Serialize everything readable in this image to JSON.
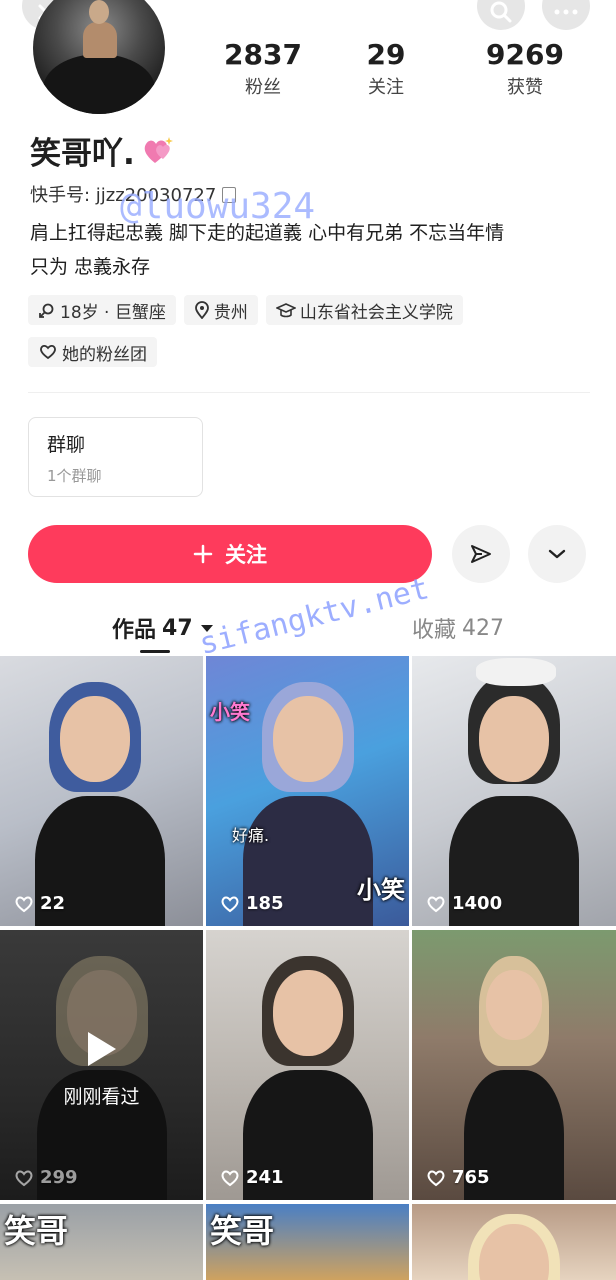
{
  "header": {
    "back_icon": "close-icon",
    "search_icon": "search-icon",
    "more_icon": "more-icon"
  },
  "profile": {
    "stats": [
      {
        "value": "2837",
        "label": "粉丝"
      },
      {
        "value": "29",
        "label": "关注"
      },
      {
        "value": "9269",
        "label": "获赞"
      }
    ],
    "nickname": "笑哥吖.",
    "kuaishou_id": "快手号: jjzz20030727",
    "bio_line1": "肩上扛得起忠義 脚下走的起道義 心中有兄弟 不忘当年情",
    "bio_line2": "只为 忠義永存",
    "tags": [
      {
        "icon": "gender-icon",
        "text": "18岁 · 巨蟹座"
      },
      {
        "icon": "location-icon",
        "text": "贵州"
      },
      {
        "icon": "school-icon",
        "text": "山东省社会主义学院"
      }
    ],
    "fan_group": "她的粉丝团"
  },
  "group_chat": {
    "title": "群聊",
    "subtitle": "1个群聊"
  },
  "actions": {
    "follow_label": "关注",
    "follow_color": "#fe3b5c"
  },
  "tabs": {
    "works_label": "作品",
    "works_count": "47",
    "favorites_label": "收藏",
    "favorites_count": "427"
  },
  "videos": [
    {
      "likes": "22"
    },
    {
      "likes": "185",
      "overlay_top": "小笑",
      "overlay_mid": "好痛.",
      "overlay_bottom": "小笑"
    },
    {
      "likes": "1400"
    },
    {
      "likes": "299",
      "status": "刚刚看过"
    },
    {
      "likes": "241"
    },
    {
      "likes": "765"
    },
    {
      "overlay_top": "笑哥"
    },
    {
      "overlay_top": "笑哥"
    },
    {}
  ],
  "watermarks": [
    "@luowu324",
    "sifangktv.net"
  ]
}
